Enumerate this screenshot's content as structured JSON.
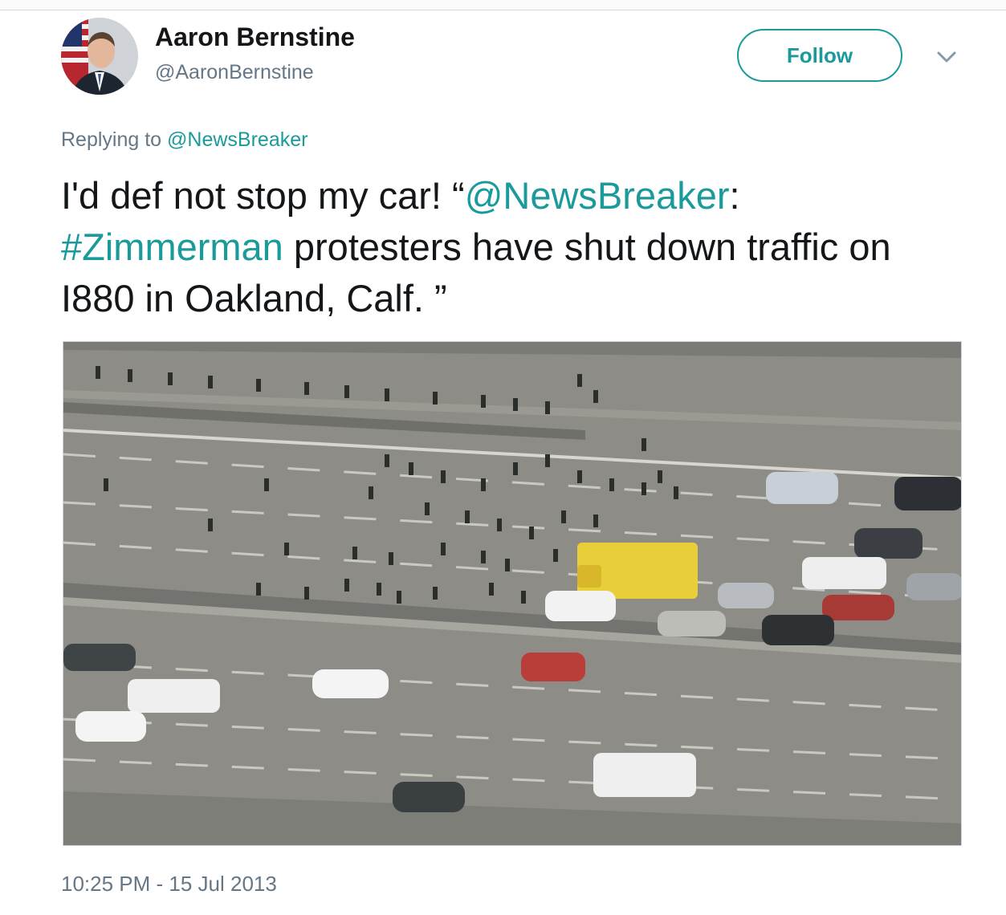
{
  "tweet": {
    "display_name": "Aaron Bernstine",
    "handle": "@AaronBernstine",
    "follow_label": "Follow",
    "reply_prefix": "Replying to",
    "reply_to": "@NewsBreaker",
    "text": {
      "part1": "I'd def not stop my car! “",
      "mention": "@NewsBreaker",
      "part2": ": ",
      "hashtag": "#Zimmerman",
      "part3": " protesters have shut down traffic on I880 in Oakland, Calf.  ”"
    },
    "timestamp": "10:25 PM - 15 Jul 2013"
  },
  "icons": {
    "caret": "chevron-down-icon",
    "avatar": "profile-photo"
  },
  "colors": {
    "accent": "#1a9a9a",
    "text": "#14171a",
    "secondary": "#657786"
  }
}
